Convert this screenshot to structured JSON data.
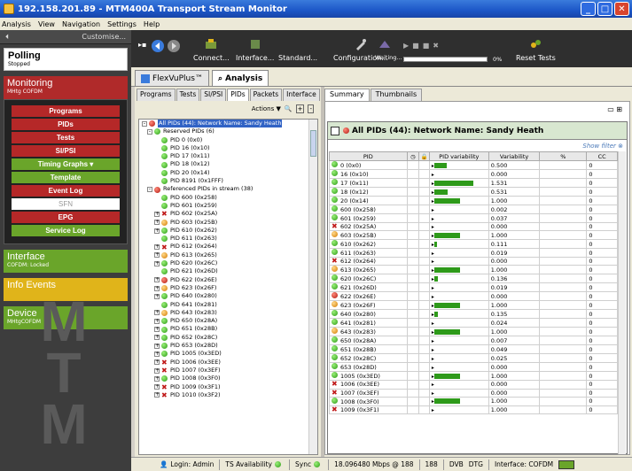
{
  "window": {
    "title": "192.158.201.89 - MTM400A Transport Stream Monitor"
  },
  "menu": [
    "Analysis",
    "View",
    "Navigation",
    "Settings",
    "Help"
  ],
  "left": {
    "customise": "Customise...",
    "polling": {
      "title": "Polling",
      "subtitle": "Stopped"
    },
    "monitoring": {
      "title": "Monitoring",
      "subtitle": "MHtg COFDM"
    },
    "nav": [
      {
        "label": "Programs",
        "style": "red"
      },
      {
        "label": "PIDs",
        "style": "red"
      },
      {
        "label": "Tests",
        "style": "red"
      },
      {
        "label": "SI/PSI",
        "style": "red"
      },
      {
        "label": "Timing Graphs",
        "style": "green"
      },
      {
        "label": "Template",
        "style": "green"
      },
      {
        "label": "Event Log",
        "style": "red"
      },
      {
        "label": "SFN",
        "style": "white"
      },
      {
        "label": "EPG",
        "style": "red"
      },
      {
        "label": "Service Log",
        "style": "green"
      }
    ],
    "interface": {
      "title": "Interface",
      "subtitle": "COFDM: Locked"
    },
    "info": {
      "title": "Info Events"
    },
    "device": {
      "title": "Device",
      "subtitle": "MHtgCOFDM"
    },
    "watermark": "MTM"
  },
  "toolbar": {
    "connect": "Connect...",
    "interface": "Interface...",
    "standard": "Standard...",
    "configuration": "Configuration...",
    "waiting": "Waiting...",
    "progress": "0%",
    "reset": "Reset Tests"
  },
  "tabs": [
    "FlexVuPlus™",
    "Analysis"
  ],
  "subtabs": [
    "Programs",
    "Tests",
    "SI/PSI",
    "PIDs",
    "Packets",
    "Interface"
  ],
  "actions": "Actions ▼",
  "tree": {
    "root": "All PIDs (44): Network Name: Sandy Heath",
    "rows": [
      {
        "lvl": 1,
        "label": "Reserved PIDs (6)",
        "led": "green",
        "tog": "-"
      },
      {
        "lvl": 2,
        "label": "PID 0 (0x0)",
        "led": "green"
      },
      {
        "lvl": 2,
        "label": "PID 16 (0x10)",
        "led": "green"
      },
      {
        "lvl": 2,
        "label": "PID 17 (0x11)",
        "led": "green"
      },
      {
        "lvl": 2,
        "label": "PID 18 (0x12)",
        "led": "green"
      },
      {
        "lvl": 2,
        "label": "PID 20 (0x14)",
        "led": "green"
      },
      {
        "lvl": 2,
        "label": "PID 8191 (0x1FFF)",
        "led": "green"
      },
      {
        "lvl": 1,
        "label": "Referenced PIDs in stream (38)",
        "led": "red",
        "tog": "-"
      },
      {
        "lvl": 2,
        "label": "PID 600 (0x258)",
        "led": "green"
      },
      {
        "lvl": 2,
        "label": "PID 601 (0x259)",
        "led": "green"
      },
      {
        "lvl": 2,
        "label": "PID 602 (0x25A)",
        "led": "x",
        "tog": "+"
      },
      {
        "lvl": 2,
        "label": "PID 603 (0x25B)",
        "led": "orange",
        "tog": "+"
      },
      {
        "lvl": 2,
        "label": "PID 610 (0x262)",
        "led": "green",
        "tog": "+"
      },
      {
        "lvl": 2,
        "label": "PID 611 (0x263)",
        "led": "green"
      },
      {
        "lvl": 2,
        "label": "PID 612 (0x264)",
        "led": "x",
        "tog": "+"
      },
      {
        "lvl": 2,
        "label": "PID 613 (0x265)",
        "led": "orange",
        "tog": "+"
      },
      {
        "lvl": 2,
        "label": "PID 620 (0x26C)",
        "led": "green",
        "tog": "+"
      },
      {
        "lvl": 2,
        "label": "PID 621 (0x26D)",
        "led": "green"
      },
      {
        "lvl": 2,
        "label": "PID 622 (0x26E)",
        "led": "red",
        "tog": "+"
      },
      {
        "lvl": 2,
        "label": "PID 623 (0x26F)",
        "led": "orange",
        "tog": "+"
      },
      {
        "lvl": 2,
        "label": "PID 640 (0x280)",
        "led": "green",
        "tog": "+"
      },
      {
        "lvl": 2,
        "label": "PID 641 (0x281)",
        "led": "green"
      },
      {
        "lvl": 2,
        "label": "PID 643 (0x283)",
        "led": "orange",
        "tog": "+"
      },
      {
        "lvl": 2,
        "label": "PID 650 (0x28A)",
        "led": "green",
        "tog": "+"
      },
      {
        "lvl": 2,
        "label": "PID 651 (0x28B)",
        "led": "green",
        "tog": "+"
      },
      {
        "lvl": 2,
        "label": "PID 652 (0x28C)",
        "led": "green",
        "tog": "+"
      },
      {
        "lvl": 2,
        "label": "PID 653 (0x28D)",
        "led": "green",
        "tog": "+"
      },
      {
        "lvl": 2,
        "label": "PID 1005 (0x3ED)",
        "led": "green",
        "tog": "+"
      },
      {
        "lvl": 2,
        "label": "PID 1006 (0x3EE)",
        "led": "x",
        "tog": "+"
      },
      {
        "lvl": 2,
        "label": "PID 1007 (0x3EF)",
        "led": "x",
        "tog": "+"
      },
      {
        "lvl": 2,
        "label": "PID 1008 (0x3F0)",
        "led": "green",
        "tog": "+"
      },
      {
        "lvl": 2,
        "label": "PID 1009 (0x3F1)",
        "led": "x",
        "tog": "+"
      },
      {
        "lvl": 2,
        "label": "PID 1010 (0x3F2)",
        "led": "x",
        "tog": "+"
      }
    ]
  },
  "right": {
    "tabs": [
      "Summary",
      "Thumbnails"
    ],
    "header": "All PIDs (44): Network Name: Sandy Heath",
    "showfilter": "Show filter",
    "columns": [
      "PID",
      "",
      "",
      "PID variability",
      "Variability",
      "%",
      "CC"
    ],
    "rows": [
      {
        "pid": "0 (0x0)",
        "led": "green",
        "bar": 0.32,
        "var": "0.500",
        "cc": "0"
      },
      {
        "pid": "16 (0x10)",
        "led": "green",
        "bar": 0,
        "var": "0.000",
        "cc": "0"
      },
      {
        "pid": "17 (0x11)",
        "led": "green",
        "bar": 1,
        "var": "1.531",
        "cc": "0"
      },
      {
        "pid": "18 (0x12)",
        "led": "green",
        "bar": 0.35,
        "var": "0.531",
        "cc": "0"
      },
      {
        "pid": "20 (0x14)",
        "led": "green",
        "bar": 0.65,
        "var": "1.000",
        "cc": "0"
      },
      {
        "pid": "600 (0x258)",
        "led": "green",
        "bar": 0,
        "var": "0.002",
        "cc": "0"
      },
      {
        "pid": "601 (0x259)",
        "led": "green",
        "bar": 0,
        "var": "0.037",
        "cc": "0"
      },
      {
        "pid": "602 (0x25A)",
        "led": "x",
        "bar": 0,
        "var": "0.000",
        "cc": "0"
      },
      {
        "pid": "603 (0x25B)",
        "led": "orange",
        "bar": 0.65,
        "var": "1.000",
        "cc": "0"
      },
      {
        "pid": "610 (0x262)",
        "led": "green",
        "bar": 0.07,
        "var": "0.111",
        "cc": "0"
      },
      {
        "pid": "611 (0x263)",
        "led": "green",
        "bar": 0,
        "var": "0.019",
        "cc": "0"
      },
      {
        "pid": "612 (0x264)",
        "led": "x",
        "bar": 0,
        "var": "0.000",
        "cc": "0"
      },
      {
        "pid": "613 (0x265)",
        "led": "orange",
        "bar": 0.65,
        "var": "1.000",
        "cc": "0"
      },
      {
        "pid": "620 (0x26C)",
        "led": "green",
        "bar": 0.09,
        "var": "0.136",
        "cc": "0"
      },
      {
        "pid": "621 (0x26D)",
        "led": "green",
        "bar": 0,
        "var": "0.019",
        "cc": "0"
      },
      {
        "pid": "622 (0x26E)",
        "led": "red",
        "bar": 0,
        "var": "0.000",
        "cc": "0"
      },
      {
        "pid": "623 (0x26F)",
        "led": "orange",
        "bar": 0.65,
        "var": "1.000",
        "cc": "0"
      },
      {
        "pid": "640 (0x280)",
        "led": "green",
        "bar": 0.09,
        "var": "0.135",
        "cc": "0"
      },
      {
        "pid": "641 (0x281)",
        "led": "green",
        "bar": 0,
        "var": "0.024",
        "cc": "0"
      },
      {
        "pid": "643 (0x283)",
        "led": "orange",
        "bar": 0.65,
        "var": "1.000",
        "cc": "0"
      },
      {
        "pid": "650 (0x28A)",
        "led": "green",
        "bar": 0,
        "var": "0.007",
        "cc": "0"
      },
      {
        "pid": "651 (0x28B)",
        "led": "green",
        "bar": 0,
        "var": "0.049",
        "cc": "0"
      },
      {
        "pid": "652 (0x28C)",
        "led": "green",
        "bar": 0,
        "var": "0.025",
        "cc": "0"
      },
      {
        "pid": "653 (0x28D)",
        "led": "green",
        "bar": 0,
        "var": "0.000",
        "cc": "0"
      },
      {
        "pid": "1005 (0x3ED)",
        "led": "green",
        "bar": 0.65,
        "var": "1.000",
        "cc": "0"
      },
      {
        "pid": "1006 (0x3EE)",
        "led": "x",
        "bar": 0,
        "var": "0.000",
        "cc": "0"
      },
      {
        "pid": "1007 (0x3EF)",
        "led": "x",
        "bar": 0,
        "var": "0.000",
        "cc": "0"
      },
      {
        "pid": "1008 (0x3F0)",
        "led": "green",
        "bar": 0.65,
        "var": "1.000",
        "cc": "0"
      },
      {
        "pid": "1009 (0x3F1)",
        "led": "x",
        "bar": 0,
        "var": "1.000",
        "cc": "0"
      }
    ]
  },
  "status": {
    "login": "Login: Admin",
    "ts": "TS Availability",
    "sync": "Sync",
    "rate": "18.096480 Mbps @ 188",
    "pkt": "188",
    "dvb": "DVB",
    "dtg": "DTG",
    "iface": "Interface: COFDM"
  },
  "colors": {
    "monitoring": "#b02a2a",
    "interface": "#6aa52a",
    "info": "#e0b41a",
    "device": "#6aa52a"
  }
}
